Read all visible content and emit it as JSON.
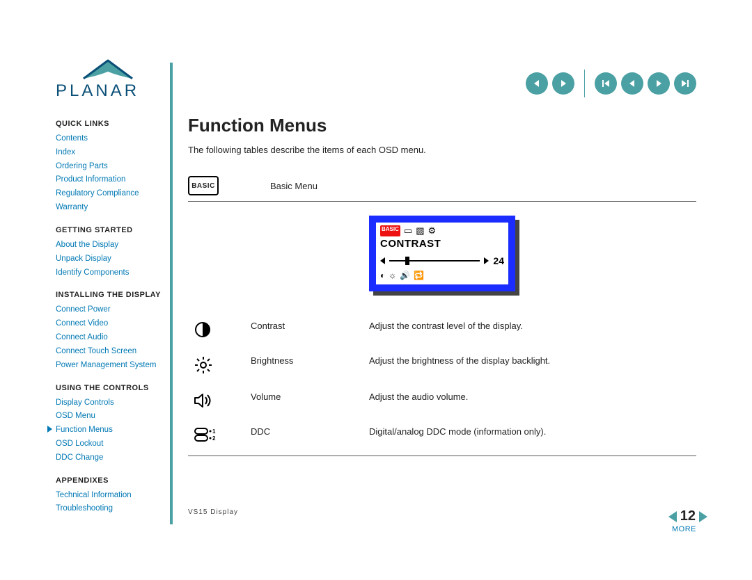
{
  "brand": "PLANAR",
  "nav_icons": [
    "prev-topic",
    "next-topic",
    "first-page",
    "prev-page",
    "next-page",
    "last-page"
  ],
  "sidebar": [
    {
      "heading": "QUICK LINKS",
      "items": [
        "Contents",
        "Index",
        "Ordering Parts",
        "Product Information",
        "Regulatory Compliance",
        "Warranty"
      ],
      "active_index": -1
    },
    {
      "heading": "GETTING STARTED",
      "items": [
        "About the Display",
        "Unpack Display",
        "Identify Components"
      ],
      "active_index": -1
    },
    {
      "heading": "INSTALLING THE DISPLAY",
      "items": [
        "Connect Power",
        "Connect Video",
        "Connect Audio",
        "Connect Touch Screen",
        "Power Management System"
      ],
      "active_index": -1
    },
    {
      "heading": "USING THE CONTROLS",
      "items": [
        "Display Controls",
        "OSD Menu",
        "Function Menus",
        "OSD Lockout",
        "DDC Change"
      ],
      "active_index": 2
    },
    {
      "heading": "APPENDIXES",
      "items": [
        "Technical Information",
        "Troubleshooting"
      ],
      "active_index": -1
    }
  ],
  "main": {
    "title": "Function Menus",
    "intro": "The following tables describe the items of each OSD menu.",
    "menu_name_badge": "BASIC",
    "menu_name_label": "Basic Menu",
    "osd": {
      "label": "CONTRAST",
      "value": "24"
    },
    "rows": [
      {
        "icon": "contrast-icon",
        "name": "Contrast",
        "desc": "Adjust the contrast level of the display."
      },
      {
        "icon": "brightness-icon",
        "name": "Brightness",
        "desc": "Adjust the brightness of the display backlight."
      },
      {
        "icon": "volume-icon",
        "name": "Volume",
        "desc": "Adjust the audio volume."
      },
      {
        "icon": "ddc-icon",
        "name": "DDC",
        "desc": "Digital/analog DDC mode (information only)."
      }
    ],
    "more_label": "MORE"
  },
  "footer": {
    "product": "VS15 Display",
    "page": "12"
  }
}
